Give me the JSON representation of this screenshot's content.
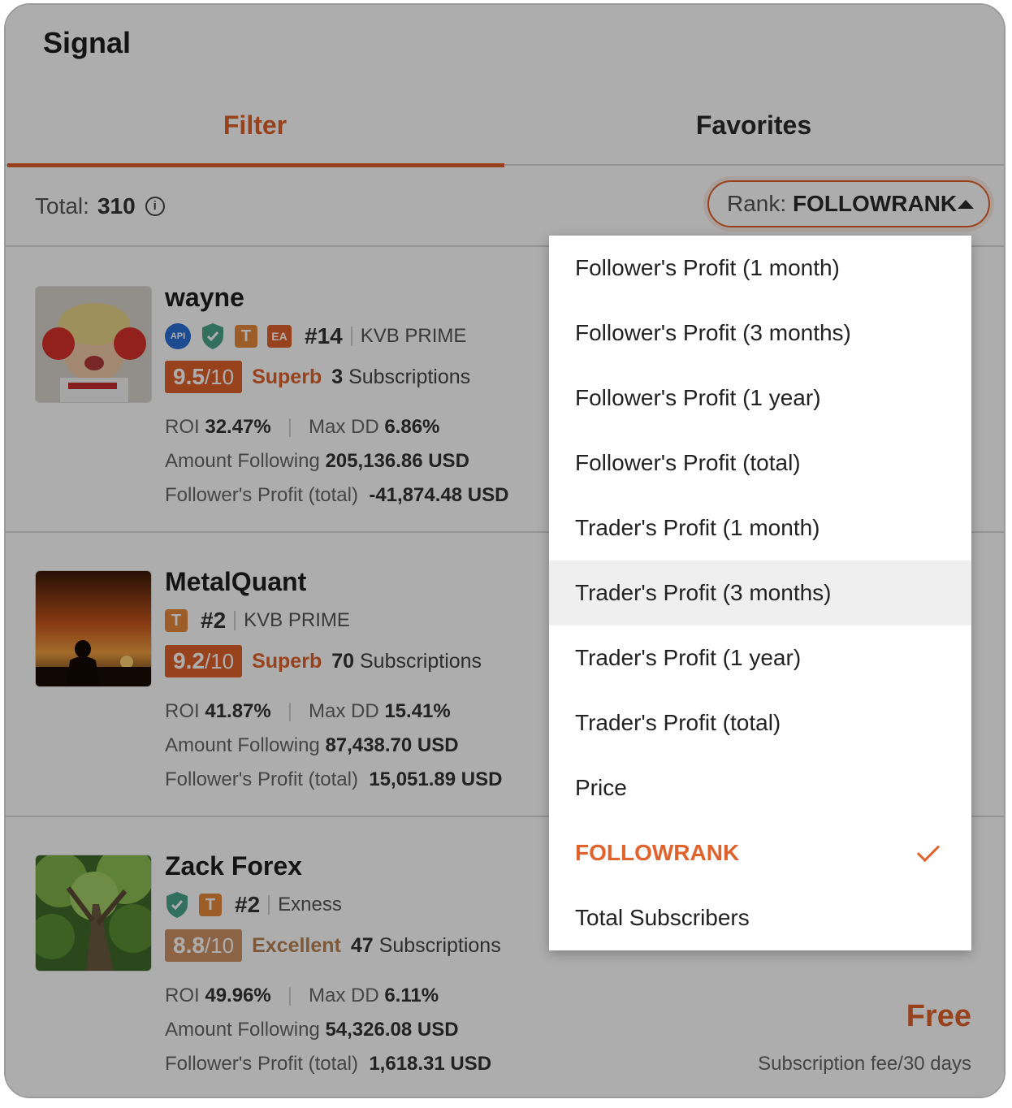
{
  "header": {
    "title": "Signal"
  },
  "tabs": [
    {
      "label": "Filter",
      "active": true
    },
    {
      "label": "Favorites",
      "active": false
    }
  ],
  "toolbar": {
    "total_label": "Total:",
    "total_value": "310",
    "rank_label": "Rank:",
    "rank_value": "FOLLOWRANK"
  },
  "traders": [
    {
      "name": "wayne",
      "badges": [
        "API",
        "shield",
        "T",
        "EA"
      ],
      "rank": "#14",
      "broker": "KVB PRIME",
      "score": "9.5",
      "score_max": "/10",
      "level": "Superb",
      "subscriptions": "3",
      "subscriptions_label": "Subscriptions",
      "roi_label": "ROI",
      "roi": "32.47%",
      "maxdd_label": "Max DD",
      "maxdd": "6.86%",
      "amount_label": "Amount Following",
      "amount": "205,136.86 USD",
      "profit_label": "Follower's Profit (total)",
      "profit": "-41,874.48 USD"
    },
    {
      "name": "MetalQuant",
      "badges": [
        "T"
      ],
      "rank": "#2",
      "broker": "KVB PRIME",
      "score": "9.2",
      "score_max": "/10",
      "level": "Superb",
      "subscriptions": "70",
      "subscriptions_label": "Subscriptions",
      "roi_label": "ROI",
      "roi": "41.87%",
      "maxdd_label": "Max DD",
      "maxdd": "15.41%",
      "amount_label": "Amount Following",
      "amount": "87,438.70 USD",
      "profit_label": "Follower's Profit (total)",
      "profit": "15,051.89 USD"
    },
    {
      "name": "Zack Forex",
      "badges": [
        "shield",
        "T"
      ],
      "rank": "#2",
      "broker": "Exness",
      "score": "8.8",
      "score_max": "/10",
      "level": "Excellent",
      "subscriptions": "47",
      "subscriptions_label": "Subscriptions",
      "roi_label": "ROI",
      "roi": "49.96%",
      "maxdd_label": "Max DD",
      "maxdd": "6.11%",
      "amount_label": "Amount Following",
      "amount": "54,326.08 USD",
      "profit_label": "Follower's Profit (total)",
      "profit": "1,618.31 USD",
      "price": "Free",
      "price_note": "Subscription fee/30 days"
    }
  ],
  "rank_menu": {
    "items": [
      "Follower's Profit (1 month)",
      "Follower's Profit (3 months)",
      "Follower's Profit (1 year)",
      "Follower's Profit (total)",
      "Trader's Profit (1 month)",
      "Trader's Profit (3 months)",
      "Trader's Profit (1 year)",
      "Trader's Profit (total)",
      "Price",
      "FOLLOWRANK",
      "Total Subscribers"
    ],
    "hovered": "Trader's Profit (3 months)",
    "selected": "FOLLOWRANK"
  },
  "colors": {
    "accent": "#e0622c",
    "excellent": "#cf9265",
    "api_badge": "#2b6fd6",
    "shield": "#4aa58a"
  }
}
